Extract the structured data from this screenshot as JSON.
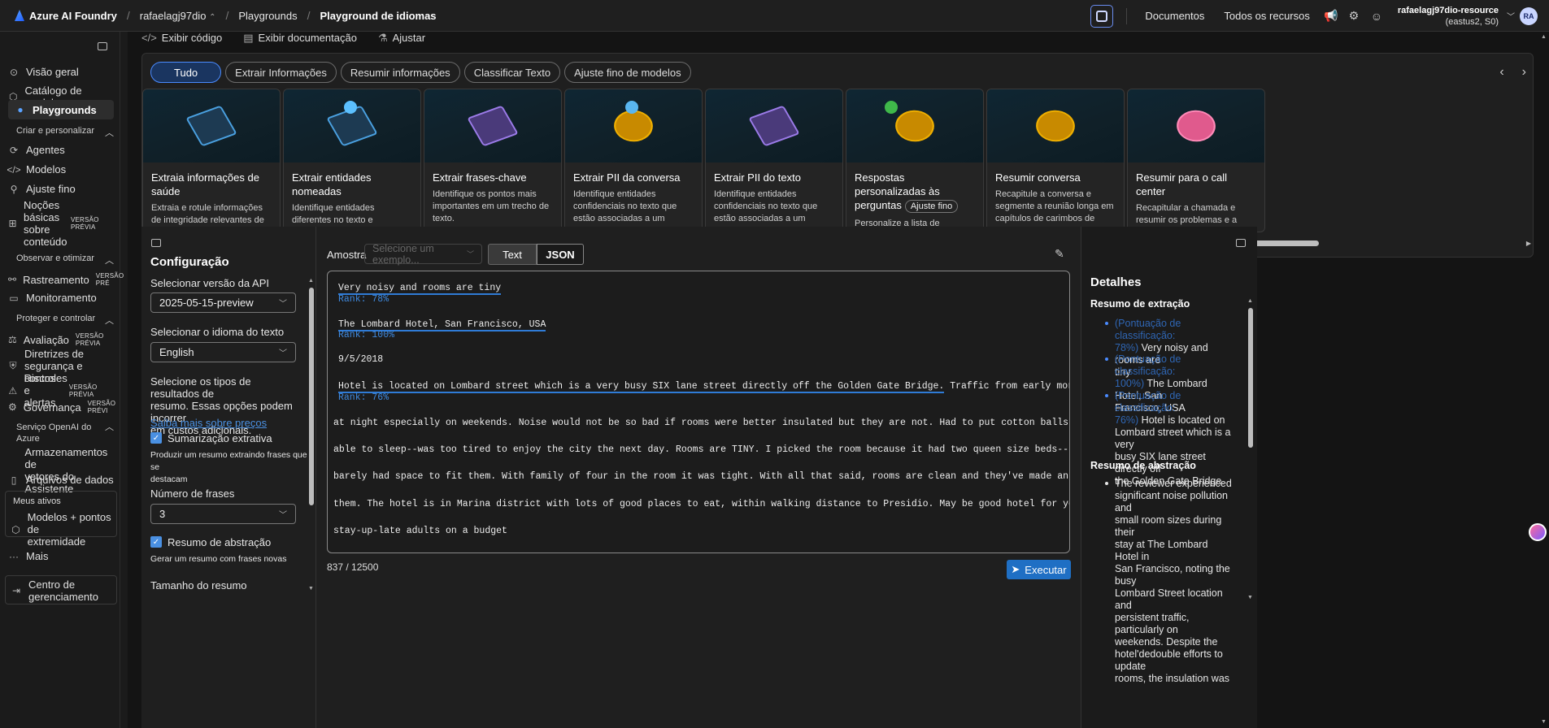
{
  "topbar": {
    "brand": "Azure AI Foundry",
    "project": "rafaelagj97dio",
    "crumb1": "Playgrounds",
    "crumb2": "Playground de idiomas",
    "docs": "Documentos",
    "resources": "Todos os recursos",
    "account_name": "rafaelagj97dio-resource",
    "account_sub": "(eastus2, S0)",
    "avatar": "RA"
  },
  "sidebar": {
    "items": [
      {
        "label": "Visão geral",
        "icon": "overview-icon"
      },
      {
        "label": "Catálogo de modelos",
        "icon": "catalog-icon"
      },
      {
        "label": "Playgrounds",
        "icon": "playground-icon"
      }
    ],
    "section_create": "Criar e personalizar",
    "create_items": [
      "Agentes",
      "Modelos",
      "Ajuste fino"
    ],
    "content_basics": [
      "Noções",
      "básicas",
      "sobre",
      "conteúdo"
    ],
    "preview_badge": "VERSÃO PRÉVIA",
    "preview_badge_short": "VERSÃO PRÉVI",
    "section_observe": "Observar e otimizar",
    "tracing": "Rastreamento",
    "tracing_badge": "VERSÃO PRÉ",
    "monitoring": "Monitoramento",
    "section_protect": "Proteger e controlar",
    "evaluation": "Avaliação",
    "guardrails": [
      "Diretrizes de",
      "segurança e controles"
    ],
    "risks": [
      "Riscos e",
      "alertas"
    ],
    "governance": "Governança",
    "section_openai": [
      "Serviço OpenAI do",
      "Azure"
    ],
    "vector_stores": [
      "Armazenamentos de",
      "vetores do Assistente"
    ],
    "data_files": "Arquivos de dados",
    "my_assets": "Meus ativos",
    "models_endpoints": [
      "Modelos + pontos de",
      "extremidade"
    ],
    "more": "Mais",
    "mgmt": [
      "Centro de",
      "gerenciamento"
    ]
  },
  "toolbar": {
    "view_code": "Exibir código",
    "view_docs": "Exibir documentação",
    "adjust": "Ajustar"
  },
  "chips": [
    "Tudo",
    "Extrair Informações",
    "Resumir informações",
    "Classificar Texto",
    "Ajuste fino de modelos"
  ],
  "cards": [
    {
      "title": "Extraia informações de saúde",
      "desc": "Extraia e rotule informações de integridade relevantes de texto não estruturado."
    },
    {
      "title": "Extrair entidades nomeadas",
      "desc": "Identifique entidades diferentes no texto e categorize-as em tipos predefinidos."
    },
    {
      "title": "Extrair frases-chave",
      "desc": "Identifique os pontos mais importantes em um trecho de texto."
    },
    {
      "title": "Extrair PII da conversa",
      "desc": "Identifique entidades confidenciais no texto que estão associadas a um indivíduo."
    },
    {
      "title": "Extrair PII do texto",
      "desc": "Identifique entidades confidenciais no texto que estão associadas a um indivíduo."
    },
    {
      "title": "Respostas personalizadas às perguntas",
      "tag": "Ajuste fino",
      "desc": "Personalize a lista de perguntas e respostas extraídas do seu corpus de conteúdo para fornecer uma"
    },
    {
      "title": "Resumir conversa",
      "desc": "Recapitule a conversa e segmente a reunião longa em capítulos de carimbos de data/hora"
    },
    {
      "title": "Resumir para o call center",
      "desc": "Recapitular a chamada e resumir os problemas e a resolução do cliente"
    }
  ],
  "config": {
    "title": "Configuração",
    "api_label": "Selecionar versão da API",
    "api_value": "2025-05-15-preview",
    "lang_label": "Selecionar o idioma do texto",
    "lang_value": "English",
    "result_types": [
      "Selecione os tipos de resultados de",
      "resumo. Essas opções podem incorrer",
      "em custos adicionais."
    ],
    "pricing_link": "Saiba mais sobre preços",
    "extractive": "Sumarização extrativa",
    "extractive_desc": [
      "Produzir um resumo extraindo frases que se",
      "destacam"
    ],
    "num_sentences_label": "Número de frases",
    "num_sentences_value": "3",
    "abstractive": "Resumo de abstração",
    "abstractive_desc": "Gerar um resumo com frases novas",
    "summary_size": "Tamanho do resumo"
  },
  "editor": {
    "sample_label": "Amostra",
    "sample_placeholder": "Selecione um exemplo...",
    "tab_text": "Text",
    "tab_json": "JSON",
    "lines": [
      {
        "text": "Very noisy and rooms are tiny",
        "rank": "Rank: 78%"
      },
      {
        "text": "The Lombard Hotel, San Francisco, USA",
        "rank": "Rank: 100%"
      },
      {
        "text": "9/5/2018"
      },
      {
        "text": "Hotel is located on Lombard street which is a very busy SIX lane street directly off the Golden Gate Bridge.",
        "rest": " Traffic from early morning until late",
        "rank": "Rank: 76%"
      },
      {
        "text": "at night especially on weekends. Noise would not be so bad if rooms were better insulated but they are not. Had to put cotton balls in my ears to be"
      },
      {
        "text": " able to sleep--was too tired to enjoy the city the next day. Rooms are TINY. I picked the room because it had two queen size beds--but the room"
      },
      {
        "text": "barely had space to fit them. With family of four in the room it was tight. With all that said, rooms are clean and they've made an effort to update"
      },
      {
        "text": " them. The hotel is in Marina district with lots of good places to eat, within walking distance to Presidio. May be good hotel for young"
      },
      {
        "text": "stay-up-late adults on a budget"
      }
    ],
    "counter": "837 / 12500",
    "run": "Executar"
  },
  "details": {
    "title": "Detalhes",
    "extract_title": "Resumo de extração",
    "extract_items": [
      {
        "score": [
          "(Pontuação de classificação:",
          "78%)"
        ],
        "text": [
          " Very noisy and rooms are",
          "tiny"
        ]
      },
      {
        "score": [
          "(Pontuação de classificação:",
          "100%)"
        ],
        "text": [
          " The Lombard Hotel, San",
          "Francisco, USA"
        ]
      },
      {
        "score": [
          "(Pontuação de classificação:",
          "76%)"
        ],
        "text": [
          " Hotel is located on",
          "Lombard street which is a very",
          "busy SIX lane street directly off",
          "the Golden Gate Bridge."
        ]
      }
    ],
    "abstract_title": "Resumo de abstração",
    "abstract_lines": [
      "The reviewer experienced",
      "significant noise pollution and",
      "small room sizes during their",
      "stay at The Lombard Hotel in",
      "San Francisco, noting the busy",
      "Lombard Street location and",
      "persistent traffic, particularly on",
      "weekends. Despite the",
      "hotel'dedouble efforts to update",
      "rooms, the insulation was"
    ]
  }
}
